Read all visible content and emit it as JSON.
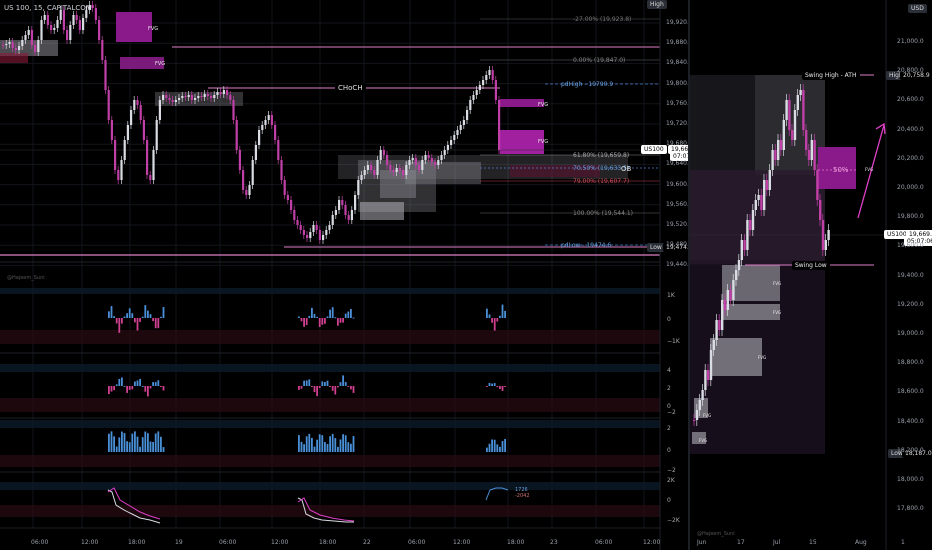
{
  "left_chart": {
    "symbol": "US 100, 15, CAPITALCOM",
    "high_tag": "High",
    "low_tag": "Low",
    "low_value": "19,474.6",
    "current_symbol": "US100",
    "current_price": "19,669.6",
    "countdown": "07:07",
    "price_axis": [
      "19,920.0",
      "19,880.0",
      "19,840.0",
      "19,800.0",
      "19,760.0",
      "19,720.0",
      "19,680.0",
      "19,640.0",
      "19,600.0",
      "19,560.0",
      "19,520.0",
      "19,480.0",
      "19,440.0"
    ],
    "time_axis": [
      "06:00",
      "12:00",
      "18:00",
      "19",
      "06:00",
      "12:00",
      "18:00",
      "22",
      "06:00",
      "12:00",
      "18:00",
      "23",
      "06:00",
      "12:00"
    ],
    "fib_levels": [
      {
        "label": "-27.00% (19,923.8)"
      },
      {
        "label": "0.00% (19,847.0)"
      },
      {
        "label": "61.80% (19,659.8)"
      },
      {
        "label": "70.50% (19,633.5)"
      },
      {
        "label": "79.00% (19,607.7)"
      },
      {
        "label": "100.00% (19,544.1)"
      }
    ],
    "annotations": {
      "choch": "CHoCH",
      "ob": "OB",
      "pdhigh": "pdHigh - 19790.9",
      "pdlow": "pdLow - 19474.6",
      "fvg": "FVG",
      "watermark": "@Hajeem_Suni"
    },
    "indicator_axes": {
      "p1": [
        "1K",
        "0",
        "−1K"
      ],
      "p2": [
        "4",
        "2",
        "0",
        "−2"
      ],
      "p3": [
        "2",
        "0",
        "−2"
      ],
      "p4": [
        "2K",
        "0",
        "−2K"
      ]
    },
    "indicator_labels": [
      "1726",
      "-2042"
    ]
  },
  "right_chart": {
    "currency": "USD",
    "high_tag": "High",
    "high_value": "20,758.9",
    "low_tag": "Low",
    "low_value": "18,187.0",
    "current_symbol": "US100",
    "current_price": "19,669.6",
    "countdown": "05:07:06",
    "price_axis": [
      "21,000.0",
      "20,800.0",
      "20,600.0",
      "20,400.0",
      "20,200.0",
      "20,000.0",
      "19,800.0",
      "19,600.0",
      "19,400.0",
      "19,200.0",
      "19,000.0",
      "18,800.0",
      "18,600.0",
      "18,400.0",
      "18,200.0",
      "18,000.0",
      "17,800.0"
    ],
    "time_axis": [
      "Jun",
      "17",
      "Jul",
      "15",
      "Aug",
      "1"
    ],
    "annotations": {
      "swing_high": "Swing High - ATH",
      "swing_low": "Swing Low",
      "fifty": "50%",
      "fvg": "FVG",
      "watermark": "@Hajeem_Suni"
    }
  },
  "colors": {
    "bull": "#d9dce3",
    "bear": "#c040a8",
    "accent": "#e040c8",
    "fvg": "#8a1a8a",
    "gray_box": "#8c8c94",
    "blue_bar": "#4a90d8",
    "pink_bar": "#d04090",
    "grid": "#15181e",
    "text": "#9aa0ab"
  }
}
